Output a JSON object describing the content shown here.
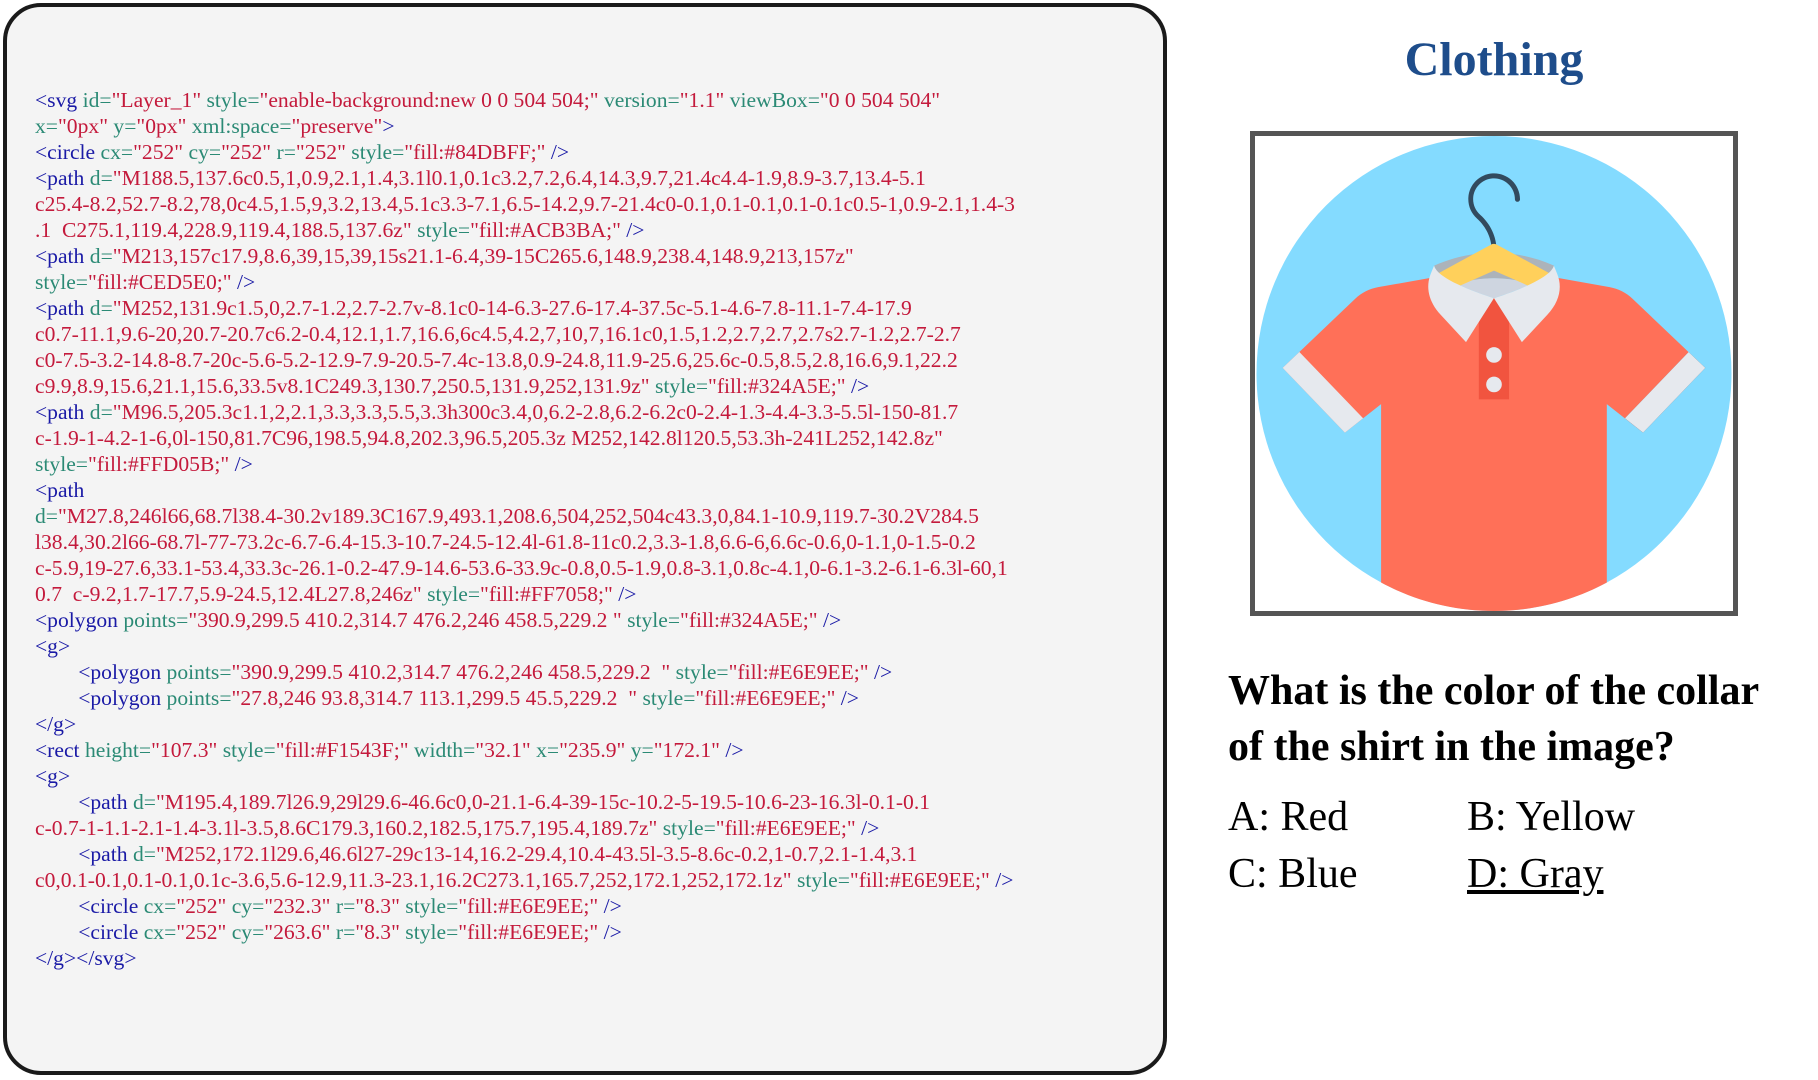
{
  "code": {
    "lines": [
      [
        {
          "c": "t",
          "s": "<svg "
        },
        {
          "c": "a",
          "s": "id="
        },
        {
          "c": "v",
          "s": "\"Layer_1\" "
        },
        {
          "c": "a",
          "s": "style="
        },
        {
          "c": "v",
          "s": "\"enable-background:new 0 0 504 504;\" "
        },
        {
          "c": "a",
          "s": "version="
        },
        {
          "c": "v",
          "s": "\"1.1\" "
        },
        {
          "c": "a",
          "s": "viewBox="
        },
        {
          "c": "v",
          "s": "\"0 0 504 504\""
        }
      ],
      [
        {
          "c": "a",
          "s": "x="
        },
        {
          "c": "v",
          "s": "\"0px\" "
        },
        {
          "c": "a",
          "s": "y="
        },
        {
          "c": "v",
          "s": "\"0px\" "
        },
        {
          "c": "a",
          "s": "xml:space="
        },
        {
          "c": "v",
          "s": "\"preserve\""
        },
        {
          "c": "t",
          "s": ">"
        }
      ],
      [
        {
          "c": "t",
          "s": "<circle "
        },
        {
          "c": "a",
          "s": "cx="
        },
        {
          "c": "v",
          "s": "\"252\" "
        },
        {
          "c": "a",
          "s": "cy="
        },
        {
          "c": "v",
          "s": "\"252\" "
        },
        {
          "c": "a",
          "s": "r="
        },
        {
          "c": "v",
          "s": "\"252\" "
        },
        {
          "c": "a",
          "s": "style="
        },
        {
          "c": "v",
          "s": "\"fill:#84DBFF;\" "
        },
        {
          "c": "t",
          "s": "/>"
        }
      ],
      [
        {
          "c": "t",
          "s": "<path "
        },
        {
          "c": "a",
          "s": "d="
        },
        {
          "c": "v",
          "s": "\"M188.5,137.6c0.5,1,0.9,2.1,1.4,3.1l0.1,0.1c3.2,7.2,6.4,14.3,9.7,21.4c4.4-1.9,8.9-3.7,13.4-5.1"
        }
      ],
      [
        {
          "c": "v",
          "s": "c25.4-8.2,52.7-8.2,78,0c4.5,1.5,9,3.2,13.4,5.1c3.3-7.1,6.5-14.2,9.7-21.4c0-0.1,0.1-0.1,0.1-0.1c0.5-1,0.9-2.1,1.4-3"
        }
      ],
      [
        {
          "c": "v",
          "s": ".1  C275.1,119.4,228.9,119.4,188.5,137.6z\" "
        },
        {
          "c": "a",
          "s": "style="
        },
        {
          "c": "v",
          "s": "\"fill:#ACB3BA;\" "
        },
        {
          "c": "t",
          "s": "/>"
        }
      ],
      [
        {
          "c": "t",
          "s": "<path "
        },
        {
          "c": "a",
          "s": "d="
        },
        {
          "c": "v",
          "s": "\"M213,157c17.9,8.6,39,15,39,15s21.1-6.4,39-15C265.6,148.9,238.4,148.9,213,157z\""
        }
      ],
      [
        {
          "c": "a",
          "s": "style="
        },
        {
          "c": "v",
          "s": "\"fill:#CED5E0;\" "
        },
        {
          "c": "t",
          "s": "/>"
        }
      ],
      [
        {
          "c": "t",
          "s": "<path "
        },
        {
          "c": "a",
          "s": "d="
        },
        {
          "c": "v",
          "s": "\"M252,131.9c1.5,0,2.7-1.2,2.7-2.7v-8.1c0-14-6.3-27.6-17.4-37.5c-5.1-4.6-7.8-11.1-7.4-17.9"
        }
      ],
      [
        {
          "c": "v",
          "s": "c0.7-11.1,9.6-20,20.7-20.7c6.2-0.4,12.1,1.7,16.6,6c4.5,4.2,7,10,7,16.1c0,1.5,1.2,2.7,2.7,2.7s2.7-1.2,2.7-2.7"
        }
      ],
      [
        {
          "c": "v",
          "s": "c0-7.5-3.2-14.8-8.7-20c-5.6-5.2-12.9-7.9-20.5-7.4c-13.8,0.9-24.8,11.9-25.6,25.6c-0.5,8.5,2.8,16.6,9.1,22.2"
        }
      ],
      [
        {
          "c": "v",
          "s": "c9.9,8.9,15.6,21.1,15.6,33.5v8.1C249.3,130.7,250.5,131.9,252,131.9z\" "
        },
        {
          "c": "a",
          "s": "style="
        },
        {
          "c": "v",
          "s": "\"fill:#324A5E;\" "
        },
        {
          "c": "t",
          "s": "/>"
        }
      ],
      [
        {
          "c": "t",
          "s": "<path "
        },
        {
          "c": "a",
          "s": "d="
        },
        {
          "c": "v",
          "s": "\"M96.5,205.3c1.1,2,2.1,3.3,3.3,5.5,3.3h300c3.4,0,6.2-2.8,6.2-6.2c0-2.4-1.3-4.4-3.3-5.5l-150-81.7"
        }
      ],
      [
        {
          "c": "v",
          "s": "c-1.9-1-4.2-1-6,0l-150,81.7C96,198.5,94.8,202.3,96.5,205.3z M252,142.8l120.5,53.3h-241L252,142.8z\""
        }
      ],
      [
        {
          "c": "a",
          "s": "style="
        },
        {
          "c": "v",
          "s": "\"fill:#FFD05B;\" "
        },
        {
          "c": "t",
          "s": "/>"
        }
      ],
      [
        {
          "c": "t",
          "s": "<path"
        }
      ],
      [
        {
          "c": "a",
          "s": "d="
        },
        {
          "c": "v",
          "s": "\"M27.8,246l66,68.7l38.4-30.2v189.3C167.9,493.1,208.6,504,252,504c43.3,0,84.1-10.9,119.7-30.2V284.5"
        }
      ],
      [
        {
          "c": "v",
          "s": "l38.4,30.2l66-68.7l-77-73.2c-6.7-6.4-15.3-10.7-24.5-12.4l-61.8-11c0.2,3.3-1.8,6.6-6,6.6c-0.6,0-1.1,0-1.5-0.2"
        }
      ],
      [
        {
          "c": "v",
          "s": "c-5.9,19-27.6,33.1-53.4,33.3c-26.1-0.2-47.9-14.6-53.6-33.9c-0.8,0.5-1.9,0.8-3.1,0.8c-4.1,0-6.1-3.2-6.1-6.3l-60,1"
        }
      ],
      [
        {
          "c": "v",
          "s": "0.7  c-9.2,1.7-17.7,5.9-24.5,12.4L27.8,246z\" "
        },
        {
          "c": "a",
          "s": "style="
        },
        {
          "c": "v",
          "s": "\"fill:#FF7058;\" "
        },
        {
          "c": "t",
          "s": "/>"
        }
      ],
      [
        {
          "c": "t",
          "s": "<polygon "
        },
        {
          "c": "a",
          "s": "points="
        },
        {
          "c": "v",
          "s": "\"390.9,299.5 410.2,314.7 476.2,246 458.5,229.2 \" "
        },
        {
          "c": "a",
          "s": "style="
        },
        {
          "c": "v",
          "s": "\"fill:#324A5E;\" "
        },
        {
          "c": "t",
          "s": "/>"
        }
      ],
      [
        {
          "c": "t",
          "s": "<g>"
        }
      ],
      [
        {
          "c": "t",
          "s": "        <polygon "
        },
        {
          "c": "a",
          "s": "points="
        },
        {
          "c": "v",
          "s": "\"390.9,299.5 410.2,314.7 476.2,246 458.5,229.2  \" "
        },
        {
          "c": "a",
          "s": "style="
        },
        {
          "c": "v",
          "s": "\"fill:#E6E9EE;\" "
        },
        {
          "c": "t",
          "s": "/>"
        }
      ],
      [
        {
          "c": "t",
          "s": "        <polygon "
        },
        {
          "c": "a",
          "s": "points="
        },
        {
          "c": "v",
          "s": "\"27.8,246 93.8,314.7 113.1,299.5 45.5,229.2  \" "
        },
        {
          "c": "a",
          "s": "style="
        },
        {
          "c": "v",
          "s": "\"fill:#E6E9EE;\" "
        },
        {
          "c": "t",
          "s": "/>"
        }
      ],
      [
        {
          "c": "t",
          "s": "</g>"
        }
      ],
      [
        {
          "c": "t",
          "s": "<rect "
        },
        {
          "c": "a",
          "s": "height="
        },
        {
          "c": "v",
          "s": "\"107.3\" "
        },
        {
          "c": "a",
          "s": "style="
        },
        {
          "c": "v",
          "s": "\"fill:#F1543F;\" "
        },
        {
          "c": "a",
          "s": "width="
        },
        {
          "c": "v",
          "s": "\"32.1\" "
        },
        {
          "c": "a",
          "s": "x="
        },
        {
          "c": "v",
          "s": "\"235.9\" "
        },
        {
          "c": "a",
          "s": "y="
        },
        {
          "c": "v",
          "s": "\"172.1\" "
        },
        {
          "c": "t",
          "s": "/>"
        }
      ],
      [
        {
          "c": "t",
          "s": "<g>"
        }
      ],
      [
        {
          "c": "t",
          "s": "        <path "
        },
        {
          "c": "a",
          "s": "d="
        },
        {
          "c": "v",
          "s": "\"M195.4,189.7l26.9,29l29.6-46.6c0,0-21.1-6.4-39-15c-10.2-5-19.5-10.6-23-16.3l-0.1-0.1"
        }
      ],
      [
        {
          "c": "v",
          "s": "c-0.7-1-1.1-2.1-1.4-3.1l-3.5,8.6C179.3,160.2,182.5,175.7,195.4,189.7z\" "
        },
        {
          "c": "a",
          "s": "style="
        },
        {
          "c": "v",
          "s": "\"fill:#E6E9EE;\" "
        },
        {
          "c": "t",
          "s": "/>"
        }
      ],
      [
        {
          "c": "t",
          "s": "        <path "
        },
        {
          "c": "a",
          "s": "d="
        },
        {
          "c": "v",
          "s": "\"M252,172.1l29.6,46.6l27-29c13-14,16.2-29.4,10.4-43.5l-3.5-8.6c-0.2,1-0.7,2.1-1.4,3.1"
        }
      ],
      [
        {
          "c": "v",
          "s": "c0,0.1-0.1,0.1-0.1,0.1c-3.6,5.6-12.9,11.3-23.1,16.2C273.1,165.7,252,172.1,252,172.1z\" "
        },
        {
          "c": "a",
          "s": "style="
        },
        {
          "c": "v",
          "s": "\"fill:#E6E9EE;\" "
        },
        {
          "c": "t",
          "s": "/>"
        }
      ],
      [
        {
          "c": "t",
          "s": "        <circle "
        },
        {
          "c": "a",
          "s": "cx="
        },
        {
          "c": "v",
          "s": "\"252\" "
        },
        {
          "c": "a",
          "s": "cy="
        },
        {
          "c": "v",
          "s": "\"232.3\" "
        },
        {
          "c": "a",
          "s": "r="
        },
        {
          "c": "v",
          "s": "\"8.3\" "
        },
        {
          "c": "a",
          "s": "style="
        },
        {
          "c": "v",
          "s": "\"fill:#E6E9EE;\" "
        },
        {
          "c": "t",
          "s": "/>"
        }
      ],
      [
        {
          "c": "t",
          "s": "        <circle "
        },
        {
          "c": "a",
          "s": "cx="
        },
        {
          "c": "v",
          "s": "\"252\" "
        },
        {
          "c": "a",
          "s": "cy="
        },
        {
          "c": "v",
          "s": "\"263.6\" "
        },
        {
          "c": "a",
          "s": "r="
        },
        {
          "c": "v",
          "s": "\"8.3\" "
        },
        {
          "c": "a",
          "s": "style="
        },
        {
          "c": "v",
          "s": "\"fill:#E6E9EE;\" "
        },
        {
          "c": "t",
          "s": "/>"
        }
      ],
      [
        {
          "c": "t",
          "s": "</g></svg>"
        }
      ]
    ]
  },
  "preview": {
    "title": "Clothing",
    "image_icon": "shirt-on-hanger-icon"
  },
  "question": {
    "line1": "What is the color of the collar",
    "line2": "of the shirt in the image?"
  },
  "options": {
    "a": "A: Red",
    "b": "B: Yellow",
    "c": "C: Blue",
    "d": "D: Gray"
  },
  "colors": {
    "title": "#1e4d8b",
    "tag": "#1a1aa6",
    "attribute": "#2b8a75",
    "value": "#c41a3c"
  }
}
